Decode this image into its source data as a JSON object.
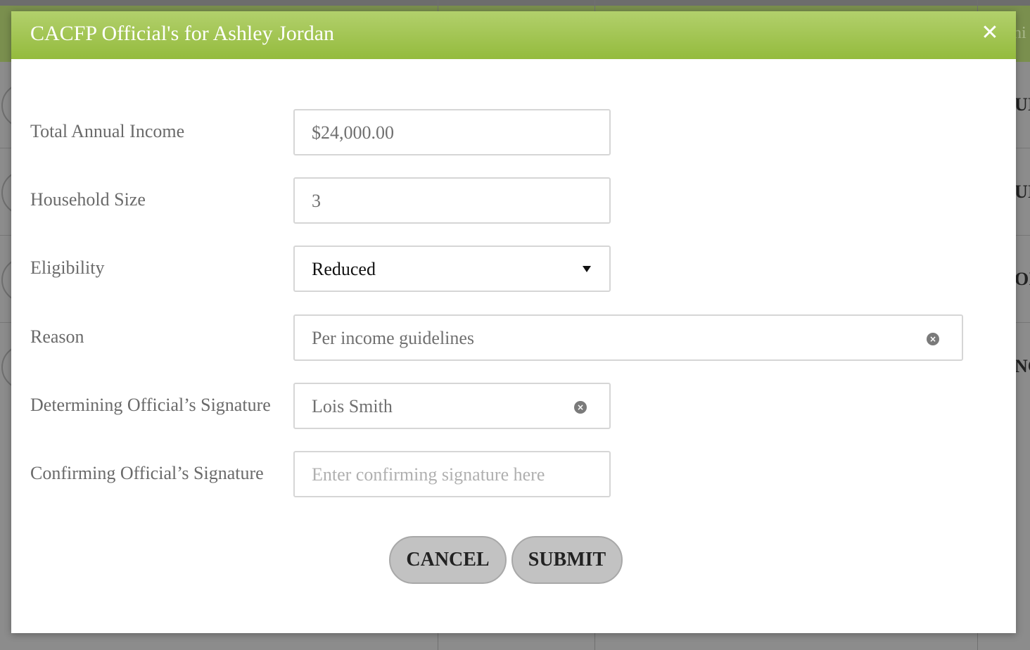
{
  "background": {
    "fragments": [
      "UI",
      "UI",
      "OI",
      "NC"
    ],
    "top_fragment": "hi"
  },
  "modal": {
    "title": "CACFP Official's for Ashley Jordan",
    "close_icon": "close-icon",
    "accent_color": "#94bb3d"
  },
  "form": {
    "income": {
      "label": "Total Annual Income",
      "value": "$24,000.00"
    },
    "household": {
      "label": "Household Size",
      "value": "3"
    },
    "eligibility": {
      "label": "Eligibility",
      "selected": "Reduced"
    },
    "reason": {
      "label": "Reason",
      "value": "Per income guidelines"
    },
    "determining": {
      "label": "Determining Official’s Signature",
      "value": "Lois Smith"
    },
    "confirming": {
      "label": "Confirming Official’s Signature",
      "placeholder": "Enter confirming signature here"
    }
  },
  "buttons": {
    "cancel": "CANCEL",
    "submit": "SUBMIT"
  }
}
